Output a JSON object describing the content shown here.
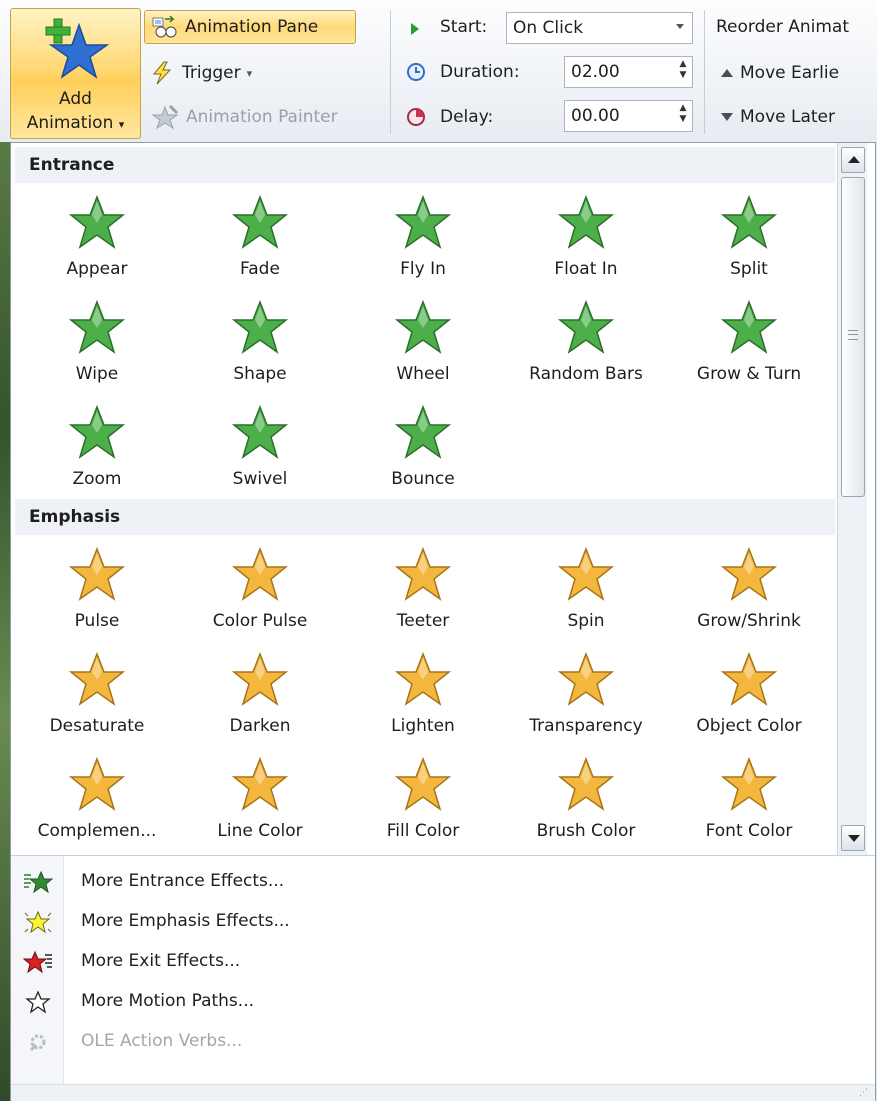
{
  "ribbon": {
    "add_animation": {
      "line1": "Add",
      "line2": "Animation",
      "arrow": "▾",
      "icon": "add-animation-star-icon"
    },
    "animation_pane": "Animation Pane",
    "trigger": "Trigger",
    "trigger_arrow": "▾",
    "animation_painter": "Animation Painter",
    "start_label": "Start:",
    "start_value": "On Click",
    "duration_label": "Duration:",
    "duration_value": "02.00",
    "delay_label": "Delay:",
    "delay_value": "00.00",
    "reorder_label": "Reorder Animat",
    "move_earlier": "Move Earlie",
    "move_later": "Move Later"
  },
  "colors": {
    "highlight": "#ffd978",
    "entrance_green": "#3e8e3a",
    "emphasis_gold": "#f0b43a",
    "exit_red": "#c9211e"
  },
  "gallery": {
    "entrance": {
      "header": "Entrance",
      "effects": [
        "Appear",
        "Fade",
        "Fly In",
        "Float In",
        "Split",
        "Wipe",
        "Shape",
        "Wheel",
        "Random Bars",
        "Grow & Turn",
        "Zoom",
        "Swivel",
        "Bounce"
      ]
    },
    "emphasis": {
      "header": "Emphasis",
      "effects": [
        "Pulse",
        "Color Pulse",
        "Teeter",
        "Spin",
        "Grow/Shrink",
        "Desaturate",
        "Darken",
        "Lighten",
        "Transparency",
        "Object Color",
        "Complemen...",
        "Line Color",
        "Fill Color",
        "Brush Color",
        "Font Color"
      ]
    }
  },
  "menu": {
    "items": [
      {
        "label": "More Entrance Effects...",
        "icon": "entrance-effects-icon",
        "disabled": false
      },
      {
        "label": "More Emphasis Effects...",
        "icon": "emphasis-effects-icon",
        "disabled": false
      },
      {
        "label": "More Exit Effects...",
        "icon": "exit-effects-icon",
        "disabled": false
      },
      {
        "label": "More Motion Paths...",
        "icon": "motion-paths-icon",
        "disabled": false
      },
      {
        "label": "OLE Action Verbs...",
        "icon": "ole-action-verbs-icon",
        "disabled": true
      }
    ]
  }
}
